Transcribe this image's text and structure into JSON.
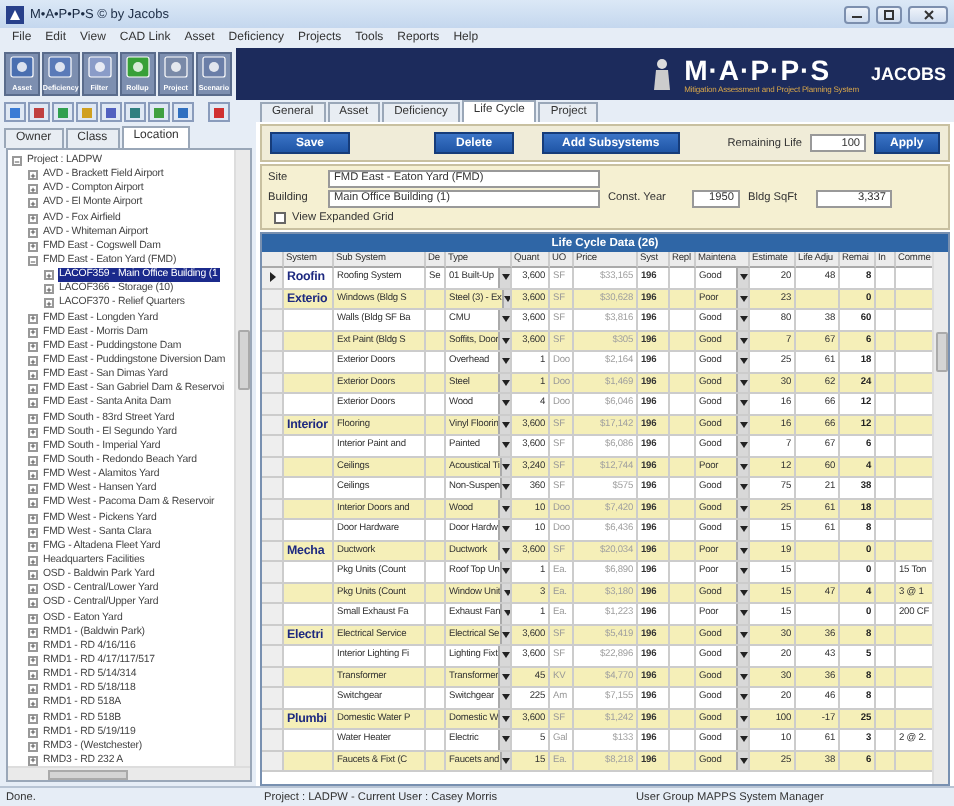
{
  "window": {
    "title": "M•A•P•P•S © by Jacobs"
  },
  "menu": [
    "File",
    "Edit",
    "View",
    "CAD Link",
    "Asset",
    "Deficiency",
    "Projects",
    "Tools",
    "Reports",
    "Help"
  ],
  "toolbar": [
    {
      "label": "Asset",
      "kind": "asset"
    },
    {
      "label": "Deficiency",
      "kind": "deficiency"
    },
    {
      "label": "Filter",
      "kind": "filter"
    },
    {
      "label": "Rollup",
      "kind": "rollup"
    },
    {
      "label": "Project",
      "kind": "project"
    },
    {
      "label": "Scenario",
      "kind": "scenario"
    }
  ],
  "banner": {
    "logo": "M·A·P·P·S",
    "subtitle": "Mitigation Assessment and Project Planning System",
    "company": "JACOBS"
  },
  "left_tabs": [
    {
      "label": "Owner",
      "selected": false
    },
    {
      "label": "Class",
      "selected": false
    },
    {
      "label": "Location",
      "selected": true
    }
  ],
  "tree": [
    {
      "label": "Project : LADPW",
      "expanded": true,
      "selected": false,
      "children": [
        {
          "label": "AVD - Brackett Field Airport",
          "expanded": false,
          "selected": false
        },
        {
          "label": "AVD - Compton Airport",
          "expanded": false,
          "selected": false
        },
        {
          "label": "AVD - El Monte Airport",
          "expanded": false,
          "selected": false
        },
        {
          "label": "AVD - Fox Airfield",
          "expanded": false,
          "selected": false
        },
        {
          "label": "AVD - Whiteman Airport",
          "expanded": false,
          "selected": false
        },
        {
          "label": "FMD East - Cogswell Dam",
          "expanded": false,
          "selected": false
        },
        {
          "label": "FMD East - Eaton Yard (FMD)",
          "expanded": true,
          "selected": false,
          "children": [
            {
              "label": "LACOF359 - Main Office Building (1",
              "expanded": false,
              "selected": true
            },
            {
              "label": "LACOF366 - Storage (10)",
              "expanded": false,
              "selected": false
            },
            {
              "label": "LACOF370 - Relief Quarters",
              "expanded": false,
              "selected": false
            }
          ]
        },
        {
          "label": "FMD East - Longden Yard",
          "expanded": false,
          "selected": false
        },
        {
          "label": "FMD East - Morris Dam",
          "expanded": false,
          "selected": false
        },
        {
          "label": "FMD East - Puddingstone Dam",
          "expanded": false,
          "selected": false
        },
        {
          "label": "FMD East - Puddingstone Diversion Dam",
          "expanded": false,
          "selected": false
        },
        {
          "label": "FMD East - San Dimas Yard",
          "expanded": false,
          "selected": false
        },
        {
          "label": "FMD East - San Gabriel Dam & Reservoi",
          "expanded": false,
          "selected": false
        },
        {
          "label": "FMD East - Santa Anita Dam",
          "expanded": false,
          "selected": false
        },
        {
          "label": "FMD South - 83rd Street Yard",
          "expanded": false,
          "selected": false
        },
        {
          "label": "FMD South - El Segundo Yard",
          "expanded": false,
          "selected": false
        },
        {
          "label": "FMD South - Imperial Yard",
          "expanded": false,
          "selected": false
        },
        {
          "label": "FMD South - Redondo Beach Yard",
          "expanded": false,
          "selected": false
        },
        {
          "label": "FMD West - Alamitos Yard",
          "expanded": false,
          "selected": false
        },
        {
          "label": "FMD West - Hansen Yard",
          "expanded": false,
          "selected": false
        },
        {
          "label": "FMD West - Pacoma Dam & Reservoir",
          "expanded": false,
          "selected": false
        },
        {
          "label": "FMD West - Pickens Yard",
          "expanded": false,
          "selected": false
        },
        {
          "label": "FMD West - Santa Clara",
          "expanded": false,
          "selected": false
        },
        {
          "label": "FMG - Altadena Fleet Yard",
          "expanded": false,
          "selected": false
        },
        {
          "label": "Headquarters Facilities",
          "expanded": false,
          "selected": false
        },
        {
          "label": "OSD - Baldwin Park Yard",
          "expanded": false,
          "selected": false
        },
        {
          "label": "OSD - Central/Lower Yard",
          "expanded": false,
          "selected": false
        },
        {
          "label": "OSD - Central/Upper Yard",
          "expanded": false,
          "selected": false
        },
        {
          "label": "OSD - Eaton Yard",
          "expanded": false,
          "selected": false
        },
        {
          "label": "RMD1 - (Baldwin Park)",
          "expanded": false,
          "selected": false
        },
        {
          "label": "RMD1 - RD 4/16/116",
          "expanded": false,
          "selected": false
        },
        {
          "label": "RMD1 - RD 4/17/117/517",
          "expanded": false,
          "selected": false
        },
        {
          "label": "RMD1 - RD 5/14/314",
          "expanded": false,
          "selected": false
        },
        {
          "label": "RMD1 - RD 5/18/118",
          "expanded": false,
          "selected": false
        },
        {
          "label": "RMD1 - RD 518A",
          "expanded": false,
          "selected": false
        },
        {
          "label": "RMD1 - RD 518B",
          "expanded": false,
          "selected": false
        },
        {
          "label": "RMD1 - RD 5/19/119",
          "expanded": false,
          "selected": false
        },
        {
          "label": "RMD3 - (Westchester)",
          "expanded": false,
          "selected": false
        },
        {
          "label": "RMD3 - RD 232 A",
          "expanded": false,
          "selected": false
        }
      ]
    }
  ],
  "tabs": [
    {
      "label": "General",
      "selected": false
    },
    {
      "label": "Asset",
      "selected": false
    },
    {
      "label": "Deficiency",
      "selected": false
    },
    {
      "label": "Life Cycle",
      "selected": true
    },
    {
      "label": "Project",
      "selected": false
    }
  ],
  "actions": {
    "save": "Save",
    "delete": "Delete",
    "add": "Add Subsystems",
    "remaining_life_label": "Remaining Life",
    "remaining_life": "100",
    "apply": "Apply"
  },
  "info": {
    "site_label": "Site",
    "site": "FMD East - Eaton Yard (FMD)",
    "building_label": "Building",
    "building": "Main Office Building (1)",
    "year_label": "Const. Year",
    "year": "1950",
    "sqft_label": "Bldg SqFt",
    "sqft": "3,337",
    "expanded_label": "View Expanded Grid",
    "expanded_grid": false
  },
  "grid": {
    "title": "Life Cycle Data (26)",
    "columns": [
      "System",
      "Sub System",
      "De",
      "Type",
      "Quant",
      "UO",
      "Price",
      "Syst",
      "Repl",
      "Maintena",
      "Estimate",
      "Life Adju",
      "Remai",
      "In",
      "Comme"
    ],
    "rows": [
      {
        "selected": true,
        "cells": [
          "Roofin",
          "Roofing System",
          "Se",
          "01 Built-Up",
          "3,600",
          "SF",
          "$33,165",
          "196",
          "",
          "Good",
          "20",
          "48",
          "8",
          "",
          ""
        ]
      },
      {
        "selected": false,
        "cells": [
          "Exterio",
          "Windows (Bldg S",
          "",
          "Steel (3) - Ex",
          "3,600",
          "SF",
          "$30,628",
          "196",
          "",
          "Poor",
          "23",
          "",
          "0",
          "",
          ""
        ]
      },
      {
        "selected": false,
        "cells": [
          "",
          "Walls (Bldg SF Ba",
          "",
          "CMU",
          "3,600",
          "SF",
          "$3,816",
          "196",
          "",
          "Good",
          "80",
          "38",
          "60",
          "",
          ""
        ]
      },
      {
        "selected": false,
        "cells": [
          "",
          "Ext Paint (Bldg S",
          "",
          "Soffits, Door",
          "3,600",
          "SF",
          "$305",
          "196",
          "",
          "Good",
          "7",
          "67",
          "6",
          "",
          ""
        ]
      },
      {
        "selected": false,
        "cells": [
          "",
          "Exterior Doors",
          "",
          "Overhead",
          "1",
          "Doo",
          "$2,164",
          "196",
          "",
          "Good",
          "25",
          "61",
          "18",
          "",
          ""
        ]
      },
      {
        "selected": false,
        "cells": [
          "",
          "Exterior Doors",
          "",
          "Steel",
          "1",
          "Doo",
          "$1,469",
          "196",
          "",
          "Good",
          "30",
          "62",
          "24",
          "",
          ""
        ]
      },
      {
        "selected": false,
        "cells": [
          "",
          "Exterior Doors",
          "",
          "Wood",
          "4",
          "Doo",
          "$6,046",
          "196",
          "",
          "Good",
          "16",
          "66",
          "12",
          "",
          ""
        ]
      },
      {
        "selected": false,
        "cells": [
          "Interior",
          "Flooring",
          "",
          "Vinyl Floorin",
          "3,600",
          "SF",
          "$17,142",
          "196",
          "",
          "Good",
          "16",
          "66",
          "12",
          "",
          ""
        ]
      },
      {
        "selected": false,
        "cells": [
          "",
          "Interior Paint and",
          "",
          "Painted",
          "3,600",
          "SF",
          "$6,086",
          "196",
          "",
          "Good",
          "7",
          "67",
          "6",
          "",
          ""
        ]
      },
      {
        "selected": false,
        "cells": [
          "",
          "Ceilings",
          "",
          "Acoustical Ti",
          "3,240",
          "SF",
          "$12,744",
          "196",
          "",
          "Poor",
          "12",
          "60",
          "4",
          "",
          ""
        ]
      },
      {
        "selected": false,
        "cells": [
          "",
          "Ceilings",
          "",
          "Non-Suspen",
          "360",
          "SF",
          "$575",
          "196",
          "",
          "Good",
          "75",
          "21",
          "38",
          "",
          ""
        ]
      },
      {
        "selected": false,
        "cells": [
          "",
          "Interior Doors and",
          "",
          "Wood",
          "10",
          "Doo",
          "$7,420",
          "196",
          "",
          "Good",
          "25",
          "61",
          "18",
          "",
          ""
        ]
      },
      {
        "selected": false,
        "cells": [
          "",
          "Door Hardware",
          "",
          "Door Hardw",
          "10",
          "Doo",
          "$6,436",
          "196",
          "",
          "Good",
          "15",
          "61",
          "8",
          "",
          ""
        ]
      },
      {
        "selected": false,
        "cells": [
          "Mecha",
          "Ductwork",
          "",
          "Ductwork",
          "3,600",
          "SF",
          "$20,034",
          "196",
          "",
          "Poor",
          "19",
          "",
          "0",
          "",
          ""
        ]
      },
      {
        "selected": false,
        "cells": [
          "",
          "Pkg Units (Count",
          "",
          "Roof Top Un",
          "1",
          "Ea.",
          "$6,890",
          "196",
          "",
          "Poor",
          "15",
          "",
          "0",
          "",
          "15 Ton"
        ]
      },
      {
        "selected": false,
        "cells": [
          "",
          "Pkg Units (Count",
          "",
          "Window Unit",
          "3",
          "Ea.",
          "$3,180",
          "196",
          "",
          "Good",
          "15",
          "47",
          "4",
          "",
          "3 @ 1"
        ]
      },
      {
        "selected": false,
        "cells": [
          "",
          "Small Exhaust Fa",
          "",
          "Exhaust Fan",
          "1",
          "Ea.",
          "$1,223",
          "196",
          "",
          "Poor",
          "15",
          "",
          "0",
          "",
          "200 CF"
        ]
      },
      {
        "selected": false,
        "cells": [
          "Electri",
          "Electrical Service",
          "",
          "Electrical Se",
          "3,600",
          "SF",
          "$5,419",
          "196",
          "",
          "Good",
          "30",
          "36",
          "8",
          "",
          ""
        ]
      },
      {
        "selected": false,
        "cells": [
          "",
          "Interior Lighting Fi",
          "",
          "Lighting Fixt",
          "3,600",
          "SF",
          "$22,896",
          "196",
          "",
          "Good",
          "20",
          "43",
          "5",
          "",
          ""
        ]
      },
      {
        "selected": false,
        "cells": [
          "",
          "Transformer",
          "",
          "Transformer",
          "45",
          "KV",
          "$4,770",
          "196",
          "",
          "Good",
          "30",
          "36",
          "8",
          "",
          ""
        ]
      },
      {
        "selected": false,
        "cells": [
          "",
          "Switchgear",
          "",
          "Switchgear",
          "225",
          "Am",
          "$7,155",
          "196",
          "",
          "Good",
          "20",
          "46",
          "8",
          "",
          ""
        ]
      },
      {
        "selected": false,
        "cells": [
          "Plumbi",
          "Domestic Water P",
          "",
          "Domestic W",
          "3,600",
          "SF",
          "$1,242",
          "196",
          "",
          "Good",
          "100",
          "-17",
          "25",
          "",
          ""
        ]
      },
      {
        "selected": false,
        "cells": [
          "",
          "Water Heater",
          "",
          "Electric",
          "5",
          "Gal",
          "$133",
          "196",
          "",
          "Good",
          "10",
          "61",
          "3",
          "",
          "2 @ 2."
        ]
      },
      {
        "selected": false,
        "cells": [
          "",
          "Faucets & Fixt (C",
          "",
          "Faucets and",
          "15",
          "Ea.",
          "$8,218",
          "196",
          "",
          "Good",
          "25",
          "38",
          "6",
          "",
          ""
        ]
      }
    ]
  },
  "status_bar": {
    "left": "Done.",
    "center": "Project : LADPW - Current User : Casey Morris",
    "right": "User Group MAPPS System Manager"
  }
}
